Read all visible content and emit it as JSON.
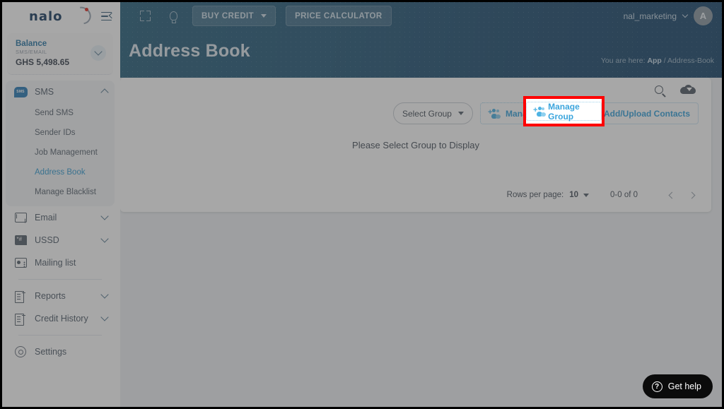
{
  "brand": {
    "logo_text": "nalo",
    "accent_red": "#e03127",
    "primary_blue": "#3ba5dd",
    "header_gradient_from": "#2d6480",
    "header_gradient_to": "#1e4a6e"
  },
  "sidebar": {
    "balance": {
      "title": "Balance",
      "subtitle": "SMS/EMAIL",
      "amount": "GHS 5,498.65"
    },
    "groups": [
      {
        "label": "SMS",
        "icon": "sms-bubble-icon",
        "expanded": true,
        "children": [
          {
            "label": "Send SMS",
            "selected": false
          },
          {
            "label": "Sender IDs",
            "selected": false
          },
          {
            "label": "Job Management",
            "selected": false
          },
          {
            "label": "Address Book",
            "selected": true
          },
          {
            "label": "Manage Blacklist",
            "selected": false
          }
        ]
      }
    ],
    "items": [
      {
        "label": "Email",
        "icon": "envelope-icon",
        "chevron": true
      },
      {
        "label": "USSD",
        "icon": "ussd-icon",
        "chevron": true
      },
      {
        "label": "Mailing list",
        "icon": "mailing-list-icon",
        "chevron": false
      },
      {
        "label": "Reports",
        "icon": "report-icon",
        "chevron": true
      },
      {
        "label": "Credit History",
        "icon": "credit-history-icon",
        "chevron": true
      },
      {
        "label": "Settings",
        "icon": "gear-icon",
        "chevron": false
      }
    ]
  },
  "header": {
    "collapse_icon": "menu-collapse-icon",
    "fullscreen_icon": "fullscreen-icon",
    "idea_icon": "lightbulb-icon",
    "buy_credit_label": "BUY CREDIT",
    "price_calculator_label": "PRICE CALCULATOR",
    "user_name": "nal_marketing",
    "avatar_initial": "A",
    "page_title": "Address Book",
    "breadcrumb_prefix": "You are here:",
    "breadcrumb_app": "App",
    "breadcrumb_sep": "/",
    "breadcrumb_current": "Address-Book"
  },
  "card": {
    "search_icon": "search-icon",
    "cloud_icon": "cloud-download-icon",
    "select_group_label": "Select Group",
    "manage_group_label": "Manage Group",
    "add_contacts_label": "Add/Upload Contacts",
    "empty_message": "Please Select Group to Display",
    "pagination": {
      "rows_label": "Rows per page:",
      "rows_value": "10",
      "range": "0-0 of 0",
      "prev": "previous-page",
      "next": "next-page"
    }
  },
  "highlight": {
    "label": "Manage Group",
    "color": "#fe0000"
  },
  "widget": {
    "get_help_label": "Get help",
    "question_glyph": "?"
  }
}
